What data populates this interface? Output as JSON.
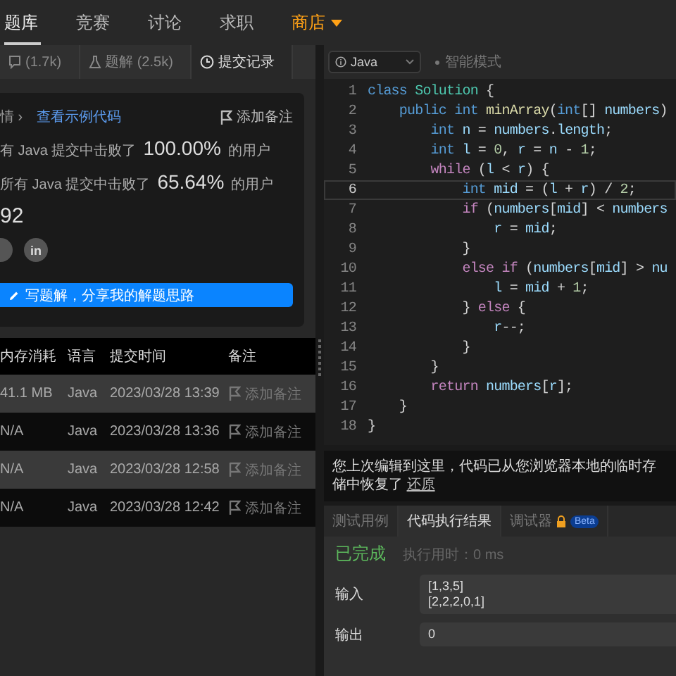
{
  "top_nav": {
    "items": [
      {
        "label": "题库",
        "selected": true,
        "kind": "link"
      },
      {
        "label": "竞赛",
        "selected": false,
        "kind": "link"
      },
      {
        "label": "讨论",
        "selected": false,
        "kind": "link"
      },
      {
        "label": "求职",
        "selected": false,
        "kind": "link"
      },
      {
        "label": "商店",
        "selected": false,
        "kind": "store"
      }
    ]
  },
  "left_panel": {
    "tabs": [
      {
        "label": "(1.7k)",
        "selected": false
      },
      {
        "label": "题解 (2.5k)",
        "selected": false
      },
      {
        "label": "提交记录",
        "selected": true
      }
    ],
    "detail_card": {
      "details_link": "情 ›",
      "example_code_link": "查看示例代码",
      "add_note": "添加备注",
      "stats": [
        {
          "prefix": "有 Java 提交中击败了",
          "value": "100.00%",
          "suffix": "的用户"
        },
        {
          "prefix": "所有 Java 提交中击败了",
          "value": "65.64%",
          "suffix": "的用户"
        }
      ],
      "score": "92",
      "social_label": "in",
      "write_solution_button": "写题解，分享我的解题思路"
    },
    "submissions": {
      "columns": [
        "内存消耗",
        "语言",
        "提交时间",
        "备注"
      ],
      "rows": [
        {
          "memory": "41.1 MB",
          "language": "Java",
          "time": "2023/03/28 13:39",
          "note": "添加备注"
        },
        {
          "memory": "N/A",
          "language": "Java",
          "time": "2023/03/28 13:36",
          "note": "添加备注"
        },
        {
          "memory": "N/A",
          "language": "Java",
          "time": "2023/03/28 12:58",
          "note": "添加备注"
        },
        {
          "memory": "N/A",
          "language": "Java",
          "time": "2023/03/28 12:42",
          "note": "添加备注"
        }
      ]
    }
  },
  "editor": {
    "language": "Java",
    "mode": "智能模式",
    "lines": [
      {
        "number": "1",
        "current": false,
        "tokens": [
          {
            "text": "class ",
            "kind": "keyword"
          },
          {
            "text": "Solution",
            "kind": "class"
          },
          {
            "text": " {",
            "kind": "plain"
          }
        ]
      },
      {
        "number": "2",
        "current": false,
        "tokens": [
          {
            "text": "    public ",
            "kind": "keyword"
          },
          {
            "text": "int ",
            "kind": "keyword"
          },
          {
            "text": "minArray",
            "kind": "function"
          },
          {
            "text": "(",
            "kind": "plain"
          },
          {
            "text": "int",
            "kind": "keyword"
          },
          {
            "text": "[] ",
            "kind": "plain"
          },
          {
            "text": "numbers",
            "kind": "variable"
          },
          {
            "text": ")",
            "kind": "plain"
          }
        ]
      },
      {
        "number": "3",
        "current": false,
        "tokens": [
          {
            "text": "        int ",
            "kind": "keyword"
          },
          {
            "text": "n",
            "kind": "variable"
          },
          {
            "text": " = ",
            "kind": "plain"
          },
          {
            "text": "numbers",
            "kind": "variable"
          },
          {
            "text": ".",
            "kind": "plain"
          },
          {
            "text": "length",
            "kind": "variable"
          },
          {
            "text": ";",
            "kind": "plain"
          }
        ]
      },
      {
        "number": "4",
        "current": false,
        "tokens": [
          {
            "text": "        int ",
            "kind": "keyword"
          },
          {
            "text": "l",
            "kind": "variable"
          },
          {
            "text": " = ",
            "kind": "plain"
          },
          {
            "text": "0",
            "kind": "number"
          },
          {
            "text": ", ",
            "kind": "plain"
          },
          {
            "text": "r",
            "kind": "variable"
          },
          {
            "text": " = ",
            "kind": "plain"
          },
          {
            "text": "n",
            "kind": "variable"
          },
          {
            "text": " - ",
            "kind": "plain"
          },
          {
            "text": "1",
            "kind": "number"
          },
          {
            "text": ";",
            "kind": "plain"
          }
        ]
      },
      {
        "number": "5",
        "current": false,
        "tokens": [
          {
            "text": "        while ",
            "kind": "control"
          },
          {
            "text": "(",
            "kind": "plain"
          },
          {
            "text": "l",
            "kind": "variable"
          },
          {
            "text": " < ",
            "kind": "plain"
          },
          {
            "text": "r",
            "kind": "variable"
          },
          {
            "text": ") {",
            "kind": "plain"
          }
        ]
      },
      {
        "number": "6",
        "current": true,
        "tokens": [
          {
            "text": "            int ",
            "kind": "keyword"
          },
          {
            "text": "mid",
            "kind": "variable"
          },
          {
            "text": " = (",
            "kind": "plain"
          },
          {
            "text": "l",
            "kind": "variable"
          },
          {
            "text": " + ",
            "kind": "plain"
          },
          {
            "text": "r",
            "kind": "variable"
          },
          {
            "text": ") / ",
            "kind": "plain"
          },
          {
            "text": "2",
            "kind": "number"
          },
          {
            "text": ";",
            "kind": "plain"
          }
        ]
      },
      {
        "number": "7",
        "current": false,
        "tokens": [
          {
            "text": "            if ",
            "kind": "control"
          },
          {
            "text": "(",
            "kind": "plain"
          },
          {
            "text": "numbers",
            "kind": "variable"
          },
          {
            "text": "[",
            "kind": "plain"
          },
          {
            "text": "mid",
            "kind": "variable"
          },
          {
            "text": "] < ",
            "kind": "plain"
          },
          {
            "text": "numbers",
            "kind": "variable"
          }
        ]
      },
      {
        "number": "8",
        "current": false,
        "tokens": [
          {
            "text": "                r",
            "kind": "variable"
          },
          {
            "text": " = ",
            "kind": "plain"
          },
          {
            "text": "mid",
            "kind": "variable"
          },
          {
            "text": ";",
            "kind": "plain"
          }
        ]
      },
      {
        "number": "9",
        "current": false,
        "tokens": [
          {
            "text": "            }",
            "kind": "plain"
          }
        ]
      },
      {
        "number": "10",
        "current": false,
        "tokens": [
          {
            "text": "            else ",
            "kind": "control"
          },
          {
            "text": "if ",
            "kind": "control"
          },
          {
            "text": "(",
            "kind": "plain"
          },
          {
            "text": "numbers",
            "kind": "variable"
          },
          {
            "text": "[",
            "kind": "plain"
          },
          {
            "text": "mid",
            "kind": "variable"
          },
          {
            "text": "] > ",
            "kind": "plain"
          },
          {
            "text": "nu",
            "kind": "variable"
          }
        ]
      },
      {
        "number": "11",
        "current": false,
        "tokens": [
          {
            "text": "                l",
            "kind": "variable"
          },
          {
            "text": " = ",
            "kind": "plain"
          },
          {
            "text": "mid",
            "kind": "variable"
          },
          {
            "text": " + ",
            "kind": "plain"
          },
          {
            "text": "1",
            "kind": "number"
          },
          {
            "text": ";",
            "kind": "plain"
          }
        ]
      },
      {
        "number": "12",
        "current": false,
        "tokens": [
          {
            "text": "            } ",
            "kind": "plain"
          },
          {
            "text": "else",
            "kind": "control"
          },
          {
            "text": " {",
            "kind": "plain"
          }
        ]
      },
      {
        "number": "13",
        "current": false,
        "tokens": [
          {
            "text": "                r",
            "kind": "variable"
          },
          {
            "text": "--;",
            "kind": "plain"
          }
        ]
      },
      {
        "number": "14",
        "current": false,
        "tokens": [
          {
            "text": "            }",
            "kind": "plain"
          }
        ]
      },
      {
        "number": "15",
        "current": false,
        "tokens": [
          {
            "text": "        }",
            "kind": "plain"
          }
        ]
      },
      {
        "number": "16",
        "current": false,
        "tokens": [
          {
            "text": "        return ",
            "kind": "control"
          },
          {
            "text": "numbers",
            "kind": "variable"
          },
          {
            "text": "[",
            "kind": "plain"
          },
          {
            "text": "r",
            "kind": "variable"
          },
          {
            "text": "];",
            "kind": "plain"
          }
        ]
      },
      {
        "number": "17",
        "current": false,
        "tokens": [
          {
            "text": "    }",
            "kind": "plain"
          }
        ]
      },
      {
        "number": "18",
        "current": false,
        "tokens": [
          {
            "text": "}",
            "kind": "plain"
          }
        ]
      }
    ]
  },
  "restore_notice": {
    "text": "您上次编辑到这里，代码已从您浏览器本地的临时存储中恢复了",
    "link": "还原"
  },
  "console": {
    "tabs": [
      {
        "label": "测试用例",
        "selected": false
      },
      {
        "label": "代码执行结果",
        "selected": true
      },
      {
        "label": "调试器",
        "selected": false,
        "badge": "Beta"
      }
    ],
    "status": "已完成",
    "runtime": "执行用时：0 ms",
    "input_label": "输入",
    "input_lines": [
      "[1,3,5]",
      "[2,2,2,0,1]"
    ],
    "output_label": "输出",
    "output_lines": [
      "0"
    ]
  }
}
